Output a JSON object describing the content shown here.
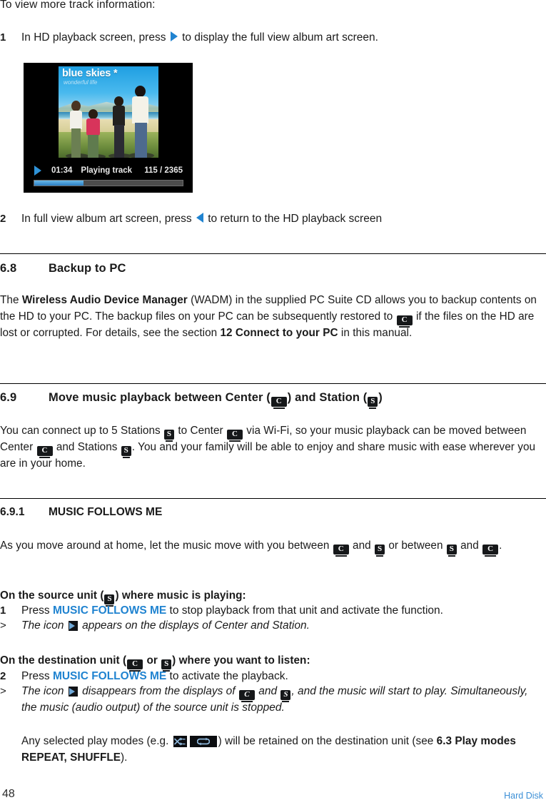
{
  "intro": "To view more track information:",
  "steps_top": [
    {
      "num": "1",
      "pre": "In HD playback screen, press ",
      "icon": "right-arrow-icon",
      "post": " to display the full view album art screen."
    },
    {
      "num": "2",
      "pre": "In full view album art screen, press ",
      "icon": "left-arrow-icon",
      "post": " to return to the HD playback screen"
    }
  ],
  "album_screenshot": {
    "album_title": "blue skies *",
    "album_subtitle": "wonderful life",
    "play_state_icon": "play-icon",
    "elapsed_time": "01:34",
    "status": "Playing track",
    "track_count": "115 / 2365",
    "progress_percent": 33,
    "accent_color": "#2f93d8",
    "background_color": "#000000"
  },
  "section_68": {
    "number": "6.8",
    "title": "Backup to PC",
    "body_a": "The ",
    "body_bold_1": "Wireless Audio Device Manager",
    "body_b": " (WADM) in the supplied PC Suite CD allows you to backup contents on the HD to your PC. The backup files on your PC can be subsequently restored to ",
    "icon_center": "C",
    "body_c": " if the files on the HD are lost or corrupted. For details, see the section ",
    "body_bold_2": "12 Connect to your PC",
    "body_d": " in this manual."
  },
  "section_69": {
    "number": "6.9",
    "title_a": "Move music playback between Center (",
    "title_icon_c": "C",
    "title_b": ") and Station (",
    "title_icon_s": "S",
    "title_c": ")",
    "body_a": "You can connect up to 5 Stations ",
    "body_b": " to Center ",
    "body_c": " via Wi-Fi, so your music playback can be moved between Center ",
    "body_d": " and Stations ",
    "body_e": ". You and your family will be able to enjoy and share music with ease wherever you are in your home."
  },
  "section_691": {
    "number": "6.9.1",
    "title": "MUSIC FOLLOWS ME",
    "intro_a": "As you move around at home, let the music move with you between ",
    "intro_b": " and ",
    "intro_c": " or between ",
    "intro_d": " and ",
    "intro_e": ".",
    "source_heading_a": "On the source unit (",
    "source_heading_b": ") where music is playing:",
    "step1_num": "1",
    "step1_a": "Press ",
    "step1_blue": "MUSIC FOLLOWS ME",
    "step1_b": " to stop playback from that unit and activate the function.",
    "note1_marker": ">",
    "note1_a": "The icon ",
    "note1_b": " appears on the displays of Center and Station.",
    "dest_heading_a": "On the destination unit (",
    "dest_heading_b": " or ",
    "dest_heading_c": ") where you want to listen:",
    "step2_num": "2",
    "step2_a": "Press ",
    "step2_blue": "MUSIC FOLLOWS ME",
    "step2_b": " to activate the playback.",
    "note2_marker": ">",
    "note2_a": "The icon ",
    "note2_b": " disappears from the displays of ",
    "note2_c": " and ",
    "note2_d": ", and the music will start to play. Simultaneously, the music (audio output) of the source unit is stopped.",
    "closing_a": "Any selected play modes (e.g. ",
    "closing_icon_shuffle": "shuffle-icon",
    "closing_icon_repeat": "repeat-icon",
    "closing_b": ") will be retained on the destination unit (see ",
    "closing_bold_1": "6.3 Play modes ",
    "closing_bold_2": "REPEAT, SHUFFLE",
    "closing_c": ")."
  },
  "icons": {
    "center_label": "C",
    "station_label": "S"
  },
  "footer": {
    "page_number": "48",
    "section_name": "Hard Disk",
    "section_color": "#3b8fd6"
  }
}
